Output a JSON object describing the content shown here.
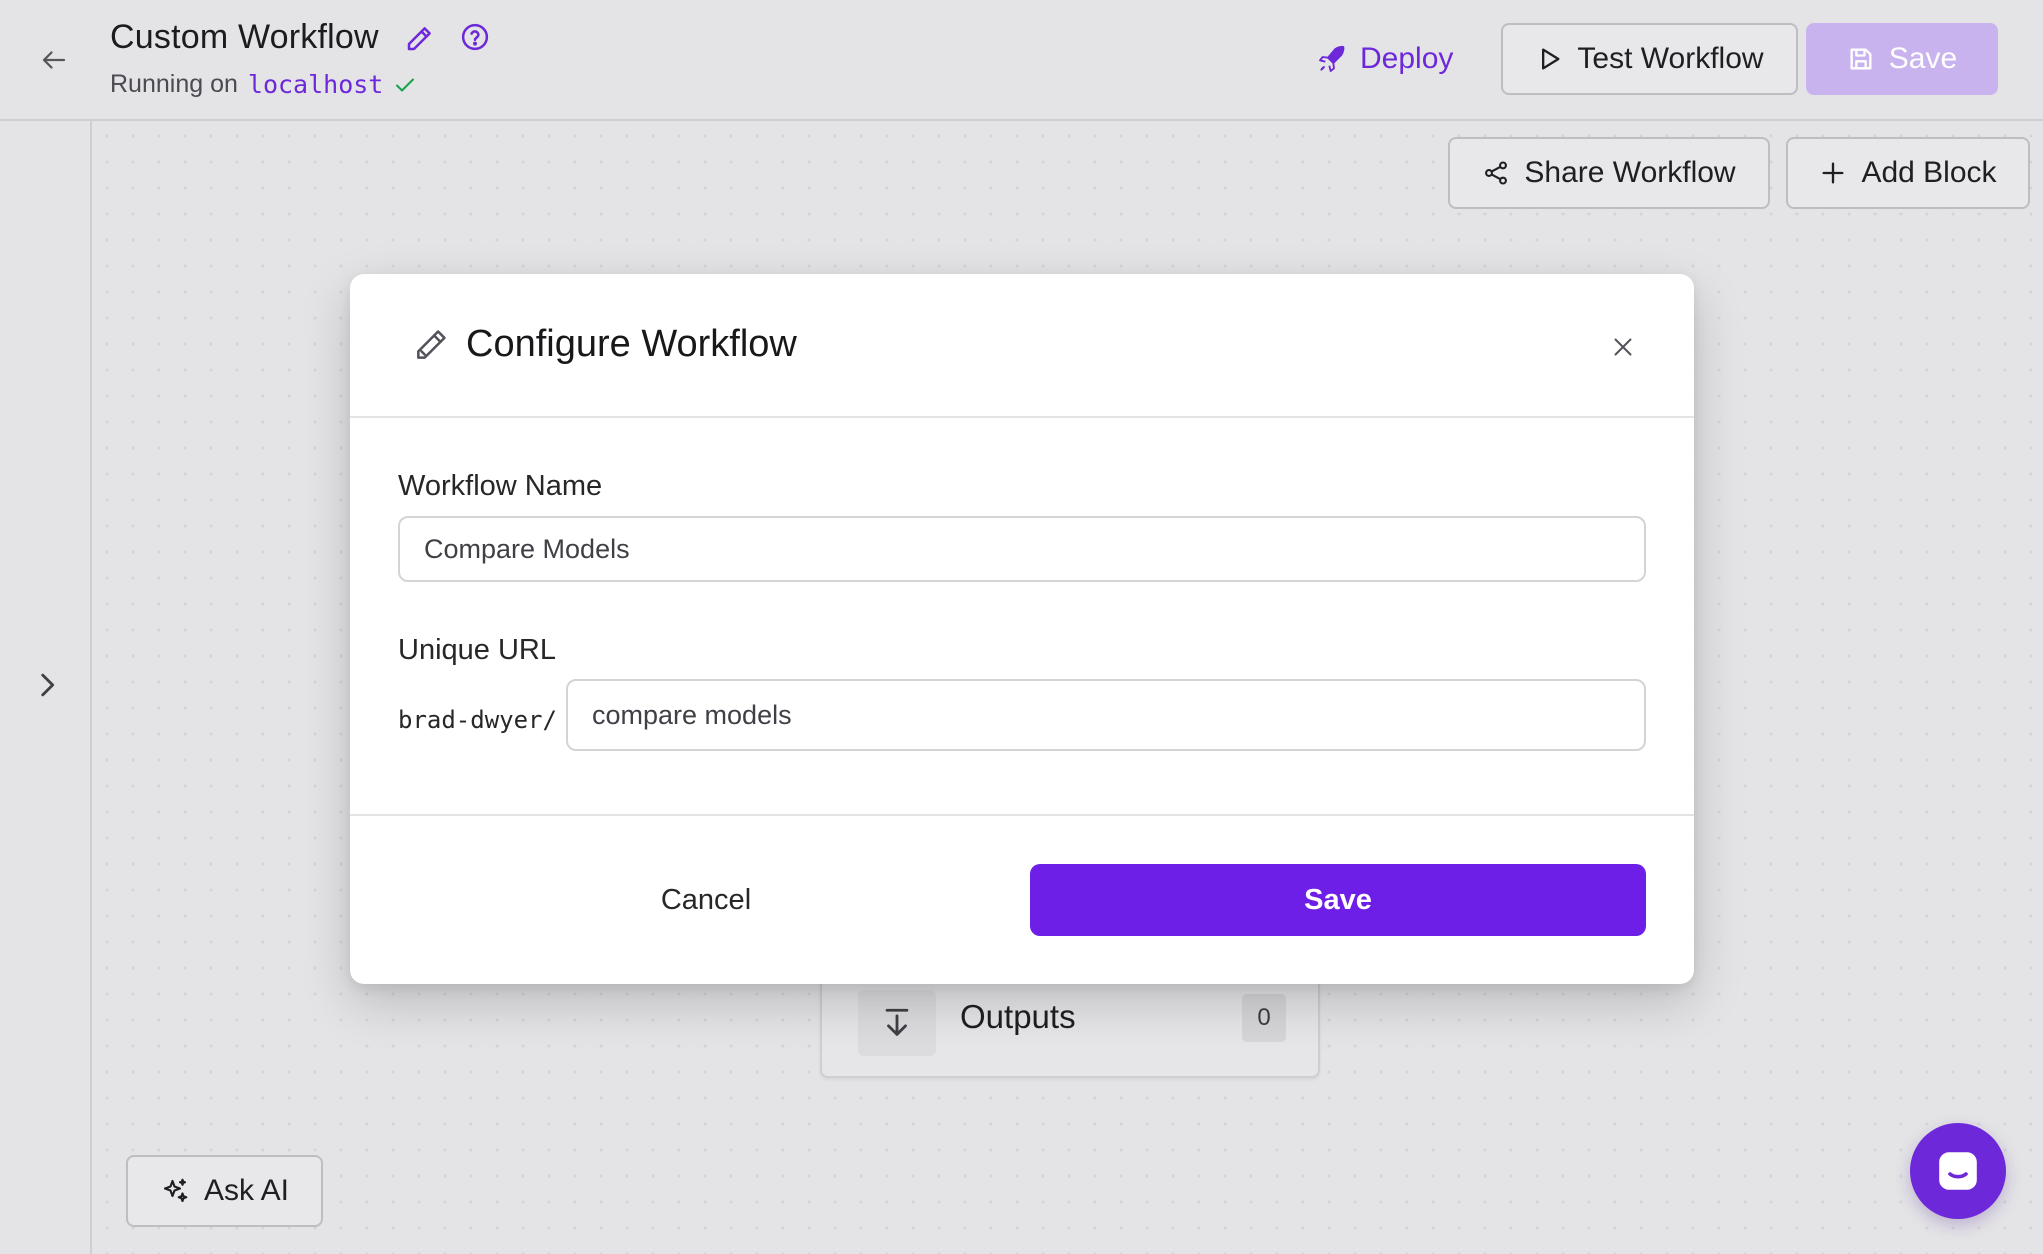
{
  "header": {
    "title": "Custom Workflow",
    "running_prefix": "Running on",
    "host": "localhost",
    "deploy_label": "Deploy",
    "test_label": "Test Workflow",
    "save_label": "Save"
  },
  "toolbar": {
    "share_label": "Share Workflow",
    "add_block_label": "Add Block"
  },
  "canvas": {
    "node": {
      "label": "Outputs",
      "count": "0"
    },
    "ask_ai_label": "Ask AI"
  },
  "modal": {
    "title": "Configure Workflow",
    "name_label": "Workflow Name",
    "name_value": "Compare Models",
    "url_label": "Unique URL",
    "url_prefix": "brad-dwyer/",
    "url_value": "compare models",
    "cancel_label": "Cancel",
    "save_label": "Save"
  },
  "colors": {
    "accent": "#6d28d9",
    "save_primary": "#6d1fe8",
    "save_disabled": "#c9b3ee",
    "background": "#e4e4e6"
  },
  "icons": [
    "arrow-left-icon",
    "pencil-icon",
    "help-circle-icon",
    "check-icon",
    "rocket-icon",
    "play-icon",
    "floppy-disk-icon",
    "share-icon",
    "plus-icon",
    "chevron-right-icon",
    "arrow-down-to-line-icon",
    "sparkles-icon",
    "chat-icon",
    "close-icon"
  ]
}
